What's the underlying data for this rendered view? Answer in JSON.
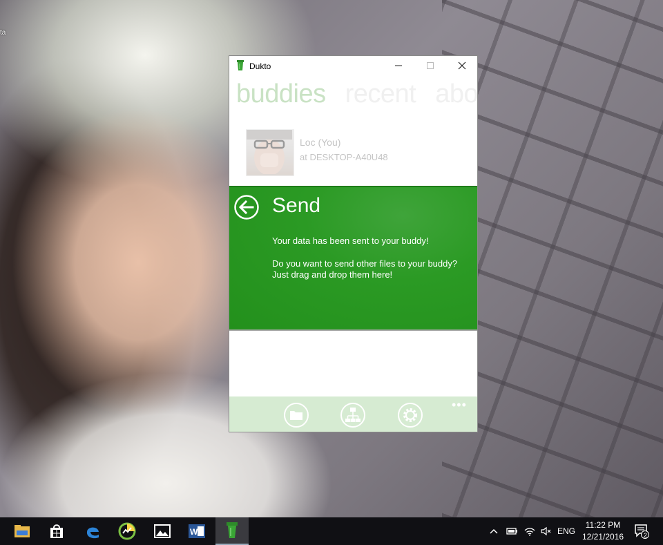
{
  "desktop": {
    "label": "ta"
  },
  "window": {
    "title": "Dukto",
    "controls": {
      "minimize": "—",
      "maximize": "☐",
      "close": "✕"
    }
  },
  "tabs": [
    "buddies",
    "recent",
    "about"
  ],
  "buddy": {
    "name": "Loc (You)",
    "host": "at DESKTOP-A40U48"
  },
  "send": {
    "title": "Send",
    "message1": "Your data has been sent to your buddy!",
    "message2": "Do you want to send other files to your buddy? Just drag and drop them here!"
  },
  "bottom_bar": {
    "icons": [
      "folder-icon",
      "network-icon",
      "settings-icon"
    ],
    "more": "•••"
  },
  "taskbar": {
    "apps": [
      "file-explorer-icon",
      "store-icon",
      "edge-icon",
      "chart-app-icon",
      "photos-icon",
      "word-icon",
      "dukto-icon"
    ],
    "tray": {
      "language": "ENG",
      "notifications": "2"
    },
    "clock": {
      "time": "11:22 PM",
      "date": "12/21/2016"
    }
  },
  "colors": {
    "accent_green": "#2b9a24",
    "bottom_bar": "#d6ebd2",
    "tab_active": "#c9e2c4"
  }
}
